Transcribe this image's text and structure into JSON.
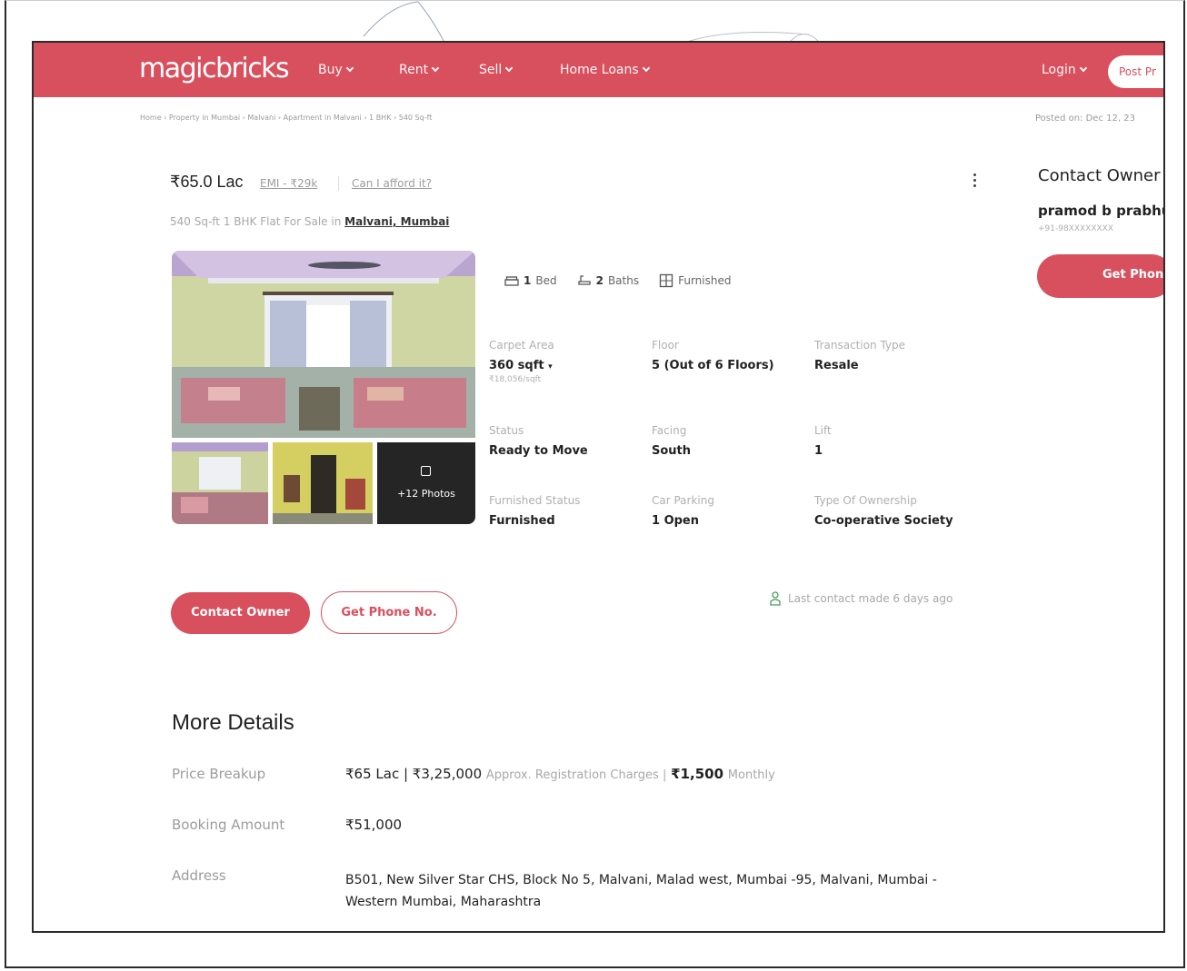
{
  "nav": {
    "logo": "magicbricks",
    "items": [
      "Buy",
      "Rent",
      "Sell",
      "Home Loans"
    ],
    "login": "Login",
    "post": "Post Pr"
  },
  "breadcrumb": "Home › Property in Mumbai › Malvani › Apartment in Malvani › 1 BHK › 540 Sq-ft",
  "posted": "Posted on: Dec 12, 23",
  "listing": {
    "price": "₹65.0 Lac",
    "emi": "EMI - ₹29k",
    "afford": "Can I afford it?",
    "subtitle": "540 Sq-ft 1 BHK Flat For Sale in",
    "location": "Malvani, Mumbai",
    "features": [
      {
        "count": "1",
        "label": "Bed",
        "icon": "bed-icon"
      },
      {
        "count": "2",
        "label": "Baths",
        "icon": "bath-icon"
      },
      {
        "count": "",
        "label": "Furnished",
        "icon": "sofa-icon"
      }
    ],
    "facts": [
      {
        "label": "Carpet Area",
        "value": "360 sqft",
        "sub": "₹18,056/sqft"
      },
      {
        "label": "Floor",
        "value": "5 (Out of 6 Floors)"
      },
      {
        "label": "Transaction Type",
        "value": "Resale"
      },
      {
        "label": "Status",
        "value": "Ready to Move"
      },
      {
        "label": "Facing",
        "value": "South"
      },
      {
        "label": "Lift",
        "value": "1"
      },
      {
        "label": "Furnished Status",
        "value": "Furnished"
      },
      {
        "label": "Car Parking",
        "value": "1 Open"
      },
      {
        "label": "Type Of Ownership",
        "value": "Co-operative Society"
      }
    ],
    "more_photos": "+12 Photos",
    "contact_owner": "Contact Owner",
    "get_phone": "Get Phone No.",
    "last_contact": "Last contact made 6 days ago"
  },
  "more_details": {
    "title": "More Details",
    "price_label": "Price Breakup",
    "price_main": "₹65 Lac | ₹3,25,000",
    "price_reg": "Approx. Registration Charges |",
    "price_monthly": "₹1,500",
    "price_monthly_suffix": "Monthly",
    "booking_label": "Booking Amount",
    "booking_value": "₹51,000",
    "address_label": "Address",
    "address_value": "B501, New Silver Star CHS, Block No 5, Malvani, Malad west, Mumbai -95, Malvani, Mumbai - Western Mumbai, Maharashtra"
  },
  "contact_panel": {
    "title": "Contact Owner",
    "name": "pramod b prabhu",
    "phone": "+91-98XXXXXXXX",
    "button": "Get Phone No."
  },
  "colors": {
    "brand": "#d8505e"
  }
}
